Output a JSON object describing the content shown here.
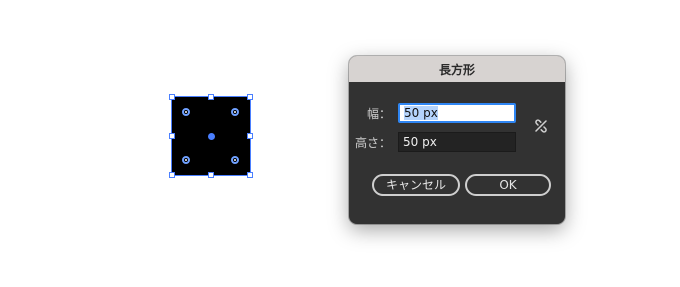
{
  "dialog": {
    "title": "長方形",
    "width_label": "幅：",
    "width_value": "50 px",
    "height_label": "高さ：",
    "height_value": "50 px",
    "constrain_icon": "broken-link-icon",
    "cancel_label": "キャンセル",
    "ok_label": "OK"
  },
  "colors": {
    "selection": "#4a7fff",
    "dialog_bg": "#323232",
    "titlebar_bg": "#d7d3d1",
    "focus_ring": "#2f86f3"
  }
}
